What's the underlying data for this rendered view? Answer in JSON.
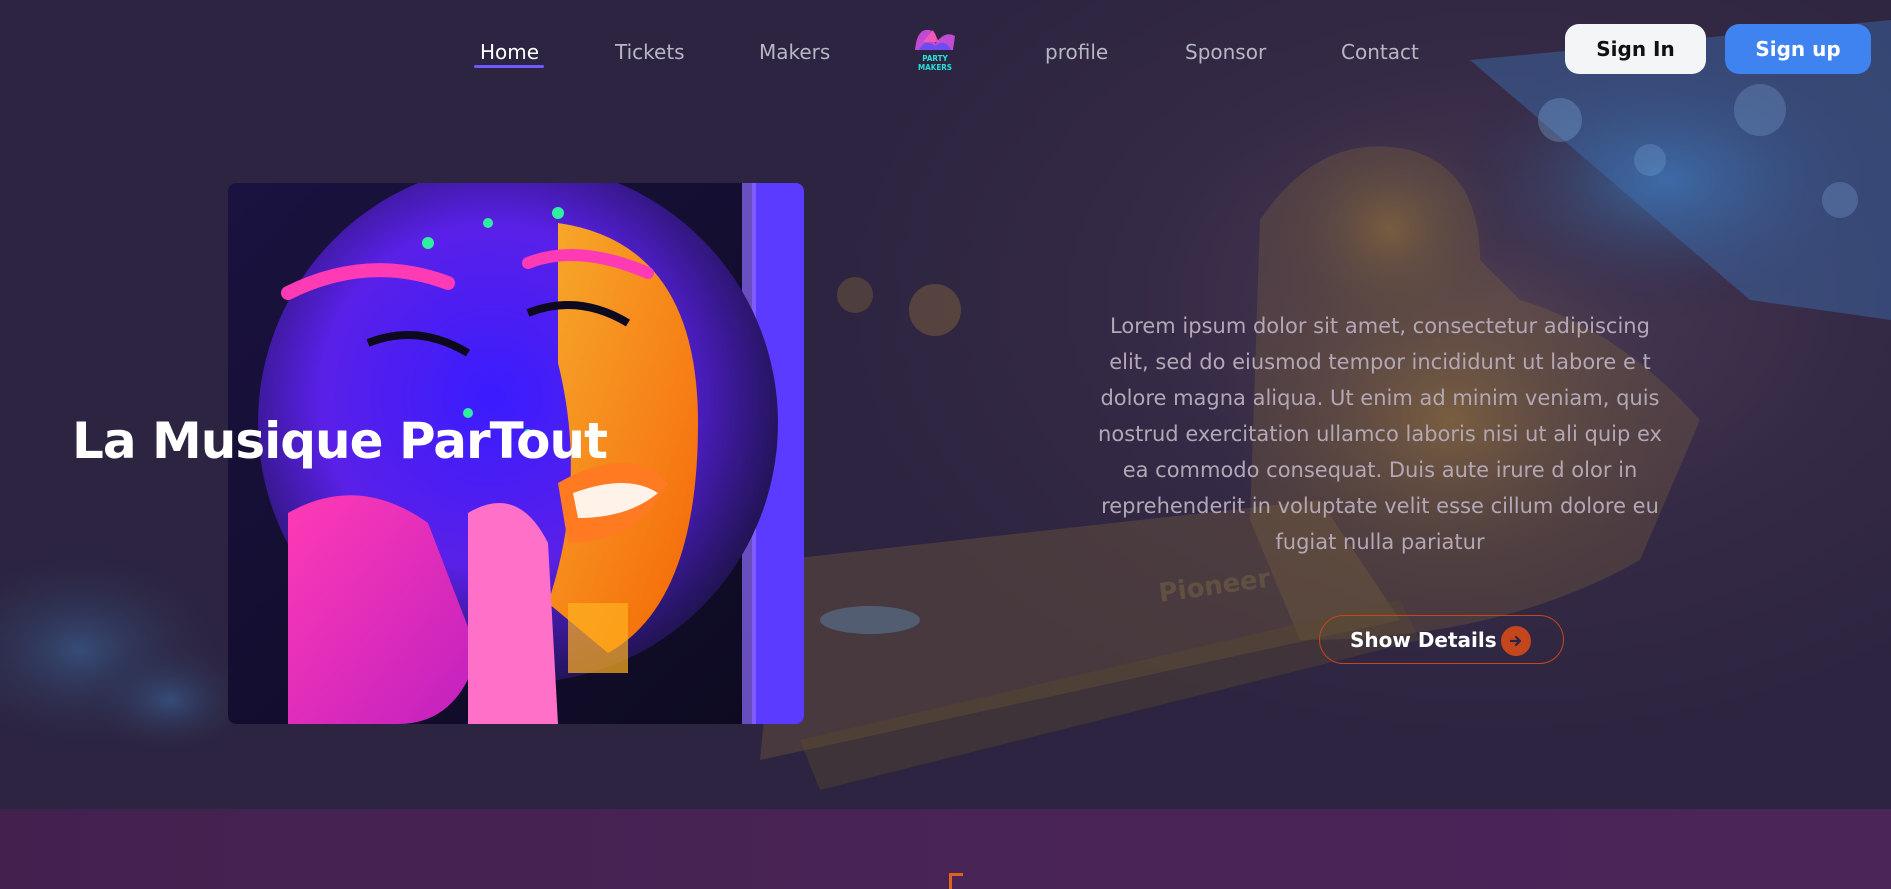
{
  "nav": {
    "links": [
      {
        "label": "Home",
        "active": true
      },
      {
        "label": "Tickets",
        "active": false
      },
      {
        "label": "Makers",
        "active": false
      },
      {
        "label": "profile",
        "active": false
      },
      {
        "label": "Sponsor",
        "active": false
      },
      {
        "label": "Contact",
        "active": false
      }
    ],
    "logo_text": "PARTY MAKERS",
    "sign_in_label": "Sign In",
    "sign_up_label": "Sign up"
  },
  "hero": {
    "title": "La Musique ParTout",
    "description": "Lorem ipsum dolor sit amet, consectetur adipiscing elit, sed do eiusmod tempor incididunt ut labore e t dolore magna aliqua. Ut enim ad minim veniam, quis nostrud exercitation ullamco laboris nisi ut ali quip ex ea commodo consequat. Duis aute irure d olor in reprehenderit in voluptate velit esse cillum dolore eu fugiat nulla pariatur",
    "details_label": "Show Details",
    "background_watermark": "Pioneer"
  },
  "colors": {
    "accent_orange": "#c4461c",
    "signup_blue": "#3f83f0",
    "nav_underline": "#6d5bff",
    "page_bg": "#2c2440"
  },
  "icons": {
    "details": "arrow-right-circle-icon",
    "logo": "party-makers-logo"
  }
}
